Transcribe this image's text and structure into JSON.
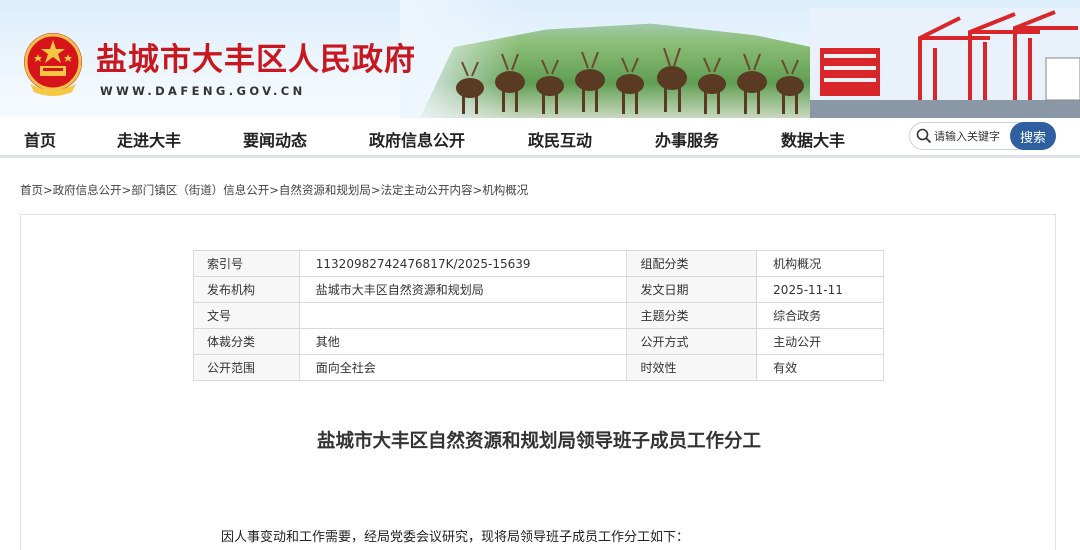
{
  "site": {
    "title": "盐城市大丰区人民政府",
    "url": "WWW.DAFENG.GOV.CN"
  },
  "nav": {
    "items": [
      "首页",
      "走进大丰",
      "要闻动态",
      "政府信息公开",
      "政民互动",
      "办事服务",
      "数据大丰"
    ],
    "search_placeholder": "请输入关键字",
    "search_button": "搜索"
  },
  "breadcrumb": [
    "首页",
    "政府信息公开",
    "部门镇区（街道）信息公开",
    "自然资源和规划局",
    "法定主动公开内容",
    "机构概况"
  ],
  "meta_table": {
    "rows": [
      {
        "k1": "索引号",
        "v1": "11320982742476817K/2025-15639",
        "k2": "组配分类",
        "v2": "机构概况"
      },
      {
        "k1": "发布机构",
        "v1": "盐城市大丰区自然资源和规划局",
        "k2": "发文日期",
        "v2": "2025-11-11"
      },
      {
        "k1": "文号",
        "v1": "",
        "k2": "主题分类",
        "v2": "综合政务"
      },
      {
        "k1": "体裁分类",
        "v1": "其他",
        "k2": "公开方式",
        "v2": "主动公开"
      },
      {
        "k1": "公开范围",
        "v1": "面向全社会",
        "k2": "时效性",
        "v2": "有效"
      }
    ]
  },
  "document": {
    "title": "盐城市大丰区自然资源和规划局领导班子成员工作分工",
    "first_paragraph": "因人事变动和工作需要，经局党委会议研究，现将局领导班子成员工作分工如下："
  },
  "colors": {
    "title_red": "#c8171e",
    "search_button_blue": "#2f5f9e"
  },
  "icons": {
    "emblem": "national-emblem-icon",
    "search": "search-icon"
  }
}
